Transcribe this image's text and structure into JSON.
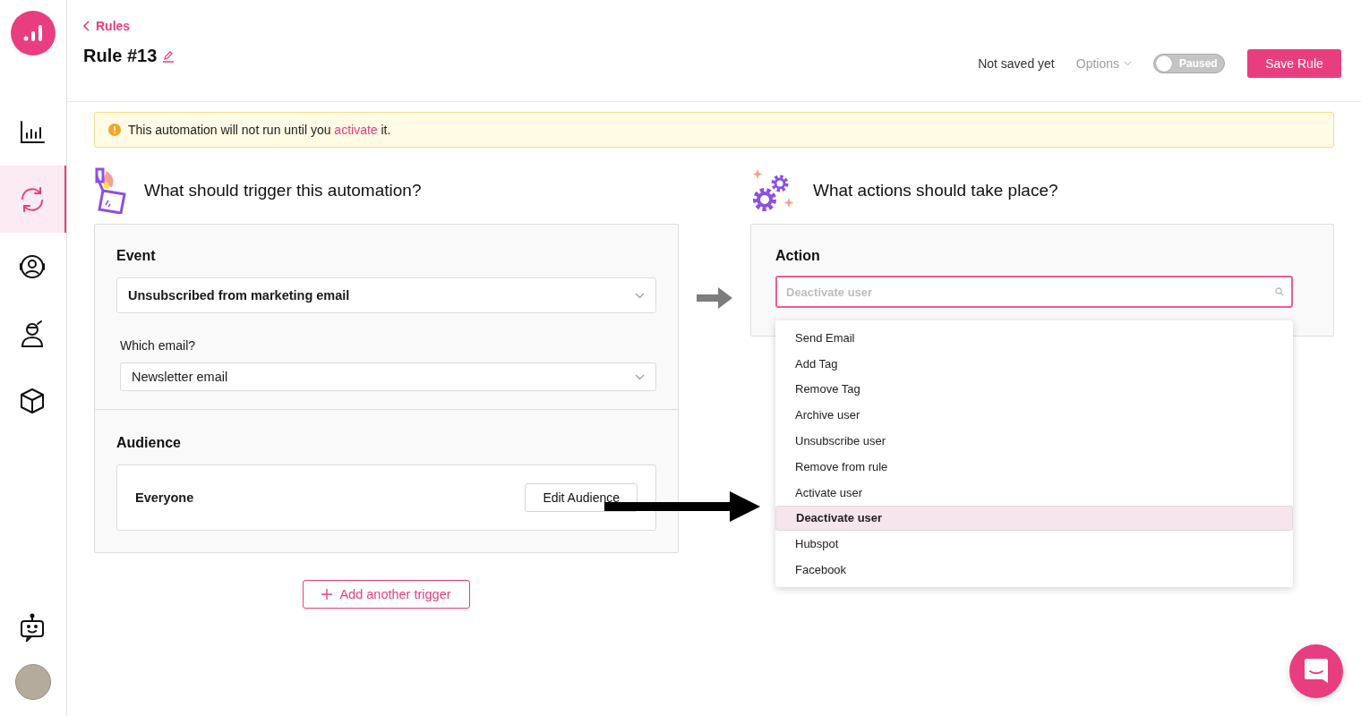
{
  "sidebar": {
    "items": [
      {
        "kind": "chart",
        "selected": false
      },
      {
        "kind": "sync",
        "selected": true
      },
      {
        "kind": "contacts",
        "selected": false
      },
      {
        "kind": "person",
        "selected": false
      },
      {
        "kind": "cube",
        "selected": false
      },
      {
        "kind": "bot",
        "selected": false
      }
    ]
  },
  "header": {
    "back_link": "Rules",
    "title": "Rule #13",
    "status": "Not saved yet",
    "options": "Options",
    "toggle": {
      "label": "Paused",
      "on": false
    },
    "save_button": "Save Rule"
  },
  "notice": {
    "text_before": "This automation will not run until you ",
    "link": "activate",
    "text_after": " it."
  },
  "trigger": {
    "heading": "What should trigger this automation?",
    "event_label": "Event",
    "event_value": "Unsubscribed from marketing email",
    "email_label": "Which email?",
    "email_value": "Newsletter email",
    "audience_label": "Audience",
    "audience_value": "Everyone",
    "edit_button": "Edit Audience",
    "add_button": "Add another trigger"
  },
  "actions": {
    "heading": "What actions should take place?",
    "label": "Action",
    "search_placeholder": "Deactivate user",
    "options": [
      {
        "label": "Send Email",
        "selected": false
      },
      {
        "label": "Add Tag",
        "selected": false
      },
      {
        "label": "Remove Tag",
        "selected": false
      },
      {
        "label": "Archive user",
        "selected": false
      },
      {
        "label": "Unsubscribe user",
        "selected": false
      },
      {
        "label": "Remove from rule",
        "selected": false
      },
      {
        "label": "Activate user",
        "selected": false
      },
      {
        "label": "Deactivate user",
        "selected": true
      },
      {
        "label": "Hubspot",
        "selected": false
      },
      {
        "label": "Facebook",
        "selected": false
      }
    ]
  }
}
